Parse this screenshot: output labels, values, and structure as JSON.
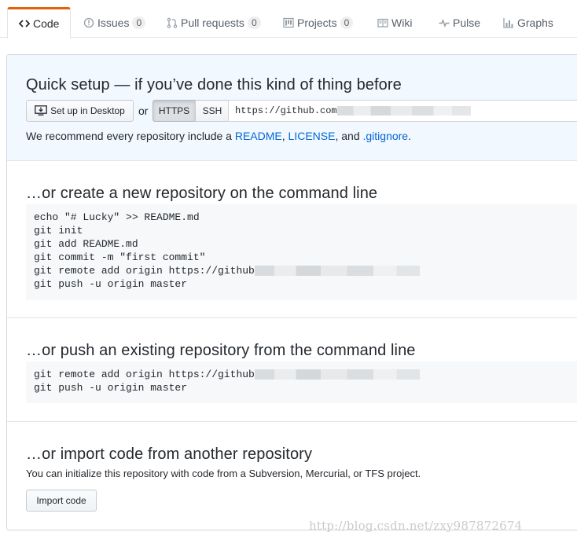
{
  "tabs": [
    {
      "label": "Code",
      "icon": "code-icon"
    },
    {
      "label": "Issues",
      "icon": "issue-opened-icon",
      "count": "0"
    },
    {
      "label": "Pull requests",
      "icon": "git-pull-request-icon",
      "count": "0"
    },
    {
      "label": "Projects",
      "icon": "project-icon",
      "count": "0"
    },
    {
      "label": "Wiki",
      "icon": "book-icon"
    },
    {
      "label": "Pulse",
      "icon": "pulse-icon"
    },
    {
      "label": "Graphs",
      "icon": "graph-icon"
    }
  ],
  "quick_setup": {
    "title": "Quick setup — if you’ve done this kind of thing before",
    "desktop_button": "Set up in Desktop",
    "or": "or",
    "https_label": "HTTPS",
    "ssh_label": "SSH",
    "url_value": "https://github.com",
    "recommend_prefix": "We recommend every repository include a ",
    "readme_link": "README",
    "sep1": ", ",
    "license_link": "LICENSE",
    "sep2": ", and ",
    "gitignore_link": ".gitignore",
    "suffix": "."
  },
  "create_section": {
    "title": "…or create a new repository on the command line",
    "lines": [
      "echo \"# Lucky\" >> README.md",
      "git init",
      "git add README.md",
      "git commit -m \"first commit\"",
      "git remote add origin https://github",
      "git push -u origin master"
    ]
  },
  "push_section": {
    "title": "…or push an existing repository from the command line",
    "lines": [
      "git remote add origin https://github",
      "git push -u origin master"
    ]
  },
  "import_section": {
    "title": "…or import code from another repository",
    "note": "You can initialize this repository with code from a Subversion, Mercurial, or TFS project.",
    "button": "Import code"
  },
  "watermark": "http://blog.csdn.net/zxy987872674",
  "colors": {
    "accent_tab": "#e36209",
    "link": "#0366d6",
    "quick_bg": "#f1f8ff",
    "code_bg": "#f6f8fa"
  }
}
